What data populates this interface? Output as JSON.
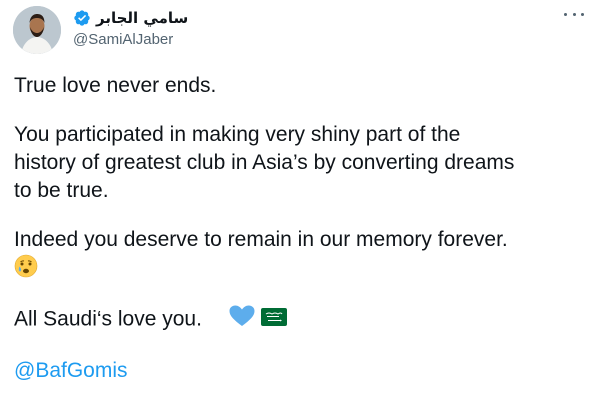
{
  "author": {
    "display_name": "سامي الجابر",
    "handle": "@SamiAlJaber",
    "verified": true,
    "avatar_icon": "user-photo-icon"
  },
  "tweet": {
    "line1": "True love never ends.",
    "para2_line1": "You participated in making very shiny part of the",
    "para2_line2": "history of greatest club in Asia’s by converting dreams",
    "para2_line3": "to be true.",
    "para3_line1": "Indeed you deserve to remain in our memory forever.",
    "para3_emoji": "crying-face-emoji",
    "para4_text": "All Saudi‘s love you.",
    "para4_emojis": [
      "blue-heart-emoji",
      "saudi-flag-emoji"
    ],
    "mention": "@BafGomis"
  },
  "colors": {
    "text": "#0f1419",
    "secondary": "#536471",
    "accent": "#1d9bf0",
    "verified": "#1d9bf0"
  }
}
